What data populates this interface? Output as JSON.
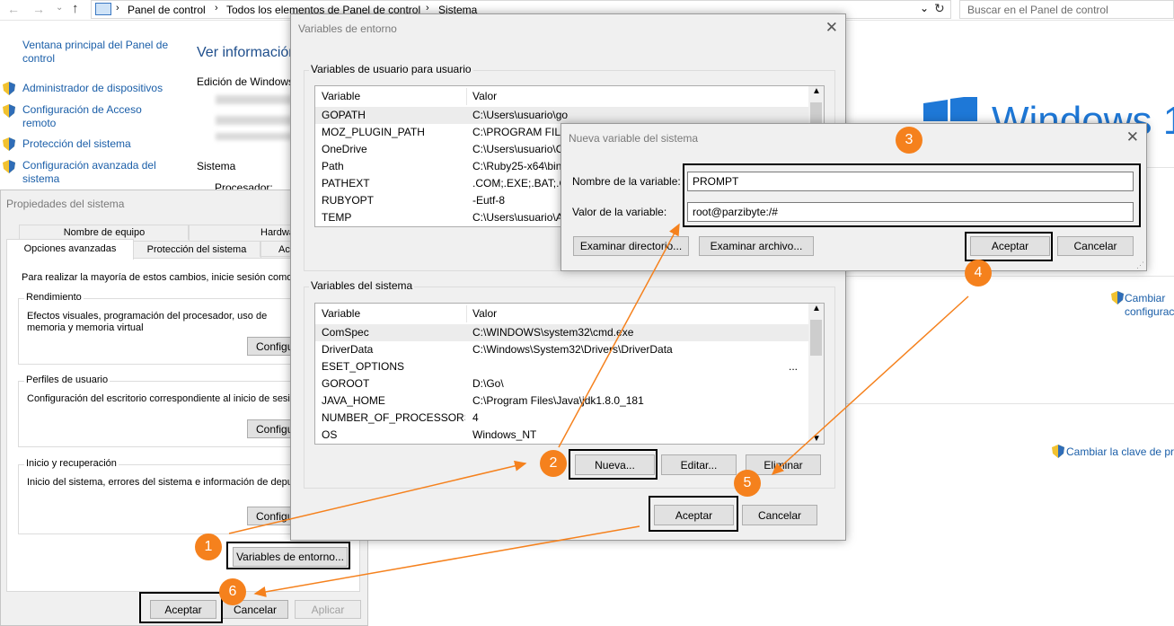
{
  "explorer": {
    "breadcrumb": [
      "Panel de control",
      "Todos los elementos de Panel de control",
      "Sistema"
    ],
    "search_placeholder": "Buscar en el Panel de control"
  },
  "sidebar": {
    "home_link": "Ventana principal del Panel de control",
    "items": [
      "Administrador de dispositivos",
      "Configuración de Acceso remoto",
      "Protección del sistema",
      "Configuración avanzada del sistema"
    ]
  },
  "main": {
    "heading": "Ver información",
    "edition": "Edición de Windows",
    "system_label": "Sistema",
    "processor_label": "Procesador:",
    "windows_logo_text": "Windows 1",
    "change_config_link": "Cambiar configuración",
    "change_key_link": "Cambiar la clave de pro"
  },
  "props": {
    "title": "Propiedades del sistema",
    "tabs_row1": [
      "Nombre de equipo",
      "Hardware"
    ],
    "tabs_row2": [
      "Opciones avanzadas",
      "Protección del sistema",
      "Acceso remoto"
    ],
    "admin_note": "Para realizar la mayoría de estos cambios, inicie sesión como administrador.",
    "perf_label": "Rendimiento",
    "perf_desc": "Efectos visuales, programación del procesador, uso de memoria y memoria virtual",
    "profiles_label": "Perfiles de usuario",
    "profiles_desc": "Configuración del escritorio correspondiente al inicio de sesión",
    "startup_label": "Inicio y recuperación",
    "startup_desc": "Inicio del sistema, errores del sistema e información de depuración",
    "configure_btn": "Configuración...",
    "env_btn": "Variables de entorno...",
    "ok": "Aceptar",
    "cancel": "Cancelar",
    "apply": "Aplicar"
  },
  "env": {
    "title": "Variables de entorno",
    "user_group": "Variables de usuario para usuario",
    "sys_group": "Variables del sistema",
    "col_variable": "Variable",
    "col_value": "Valor",
    "user_vars": [
      {
        "name": "GOPATH",
        "value": "C:\\Users\\usuario\\go"
      },
      {
        "name": "MOZ_PLUGIN_PATH",
        "value": "C:\\PROGRAM FILES"
      },
      {
        "name": "OneDrive",
        "value": "C:\\Users\\usuario\\O"
      },
      {
        "name": "Path",
        "value": "C:\\Ruby25-x64\\bin;"
      },
      {
        "name": "PATHEXT",
        "value": ".COM;.EXE;.BAT;.CI"
      },
      {
        "name": "RUBYOPT",
        "value": "-Eutf-8"
      },
      {
        "name": "TEMP",
        "value": "C:\\Users\\usuario\\A"
      }
    ],
    "sys_vars": [
      {
        "name": "ComSpec",
        "value": "C:\\WINDOWS\\system32\\cmd.exe"
      },
      {
        "name": "DriverData",
        "value": "C:\\Windows\\System32\\Drivers\\DriverData"
      },
      {
        "name": "ESET_OPTIONS",
        "value": "..."
      },
      {
        "name": "GOROOT",
        "value": "D:\\Go\\"
      },
      {
        "name": "JAVA_HOME",
        "value": "C:\\Program Files\\Java\\jdk1.8.0_181"
      },
      {
        "name": "NUMBER_OF_PROCESSORS",
        "value": "4"
      },
      {
        "name": "OS",
        "value": "Windows_NT"
      }
    ],
    "new_btn": "Nueva...",
    "edit_btn": "Editar...",
    "delete_btn": "Eliminar",
    "ok": "Aceptar",
    "cancel": "Cancelar"
  },
  "newvar": {
    "title": "Nueva variable del sistema",
    "name_label": "Nombre de la variable:",
    "name_value": "PROMPT",
    "value_label": "Valor de la variable:",
    "value_value": "root@parzibyte:/#",
    "browse_dir": "Examinar directorio...",
    "browse_file": "Examinar archivo...",
    "ok": "Aceptar",
    "cancel": "Cancelar"
  },
  "steps": [
    "1",
    "2",
    "3",
    "4",
    "5",
    "6"
  ],
  "colors": {
    "accent": "#f5811d",
    "link": "#1a5ea8",
    "dialog_bg": "#f0f0f0",
    "selection": "#e5f3ff"
  }
}
